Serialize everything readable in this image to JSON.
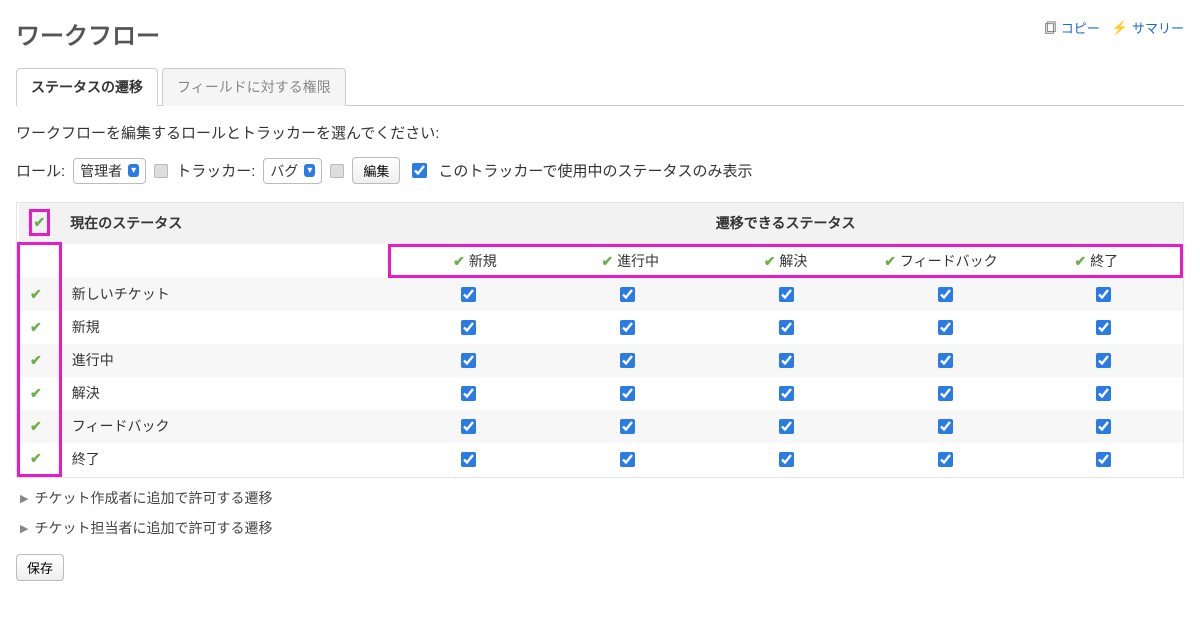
{
  "header": {
    "title": "ワークフロー",
    "links": {
      "copy": "コピー",
      "summary": "サマリー"
    }
  },
  "tabs": {
    "status_transition": "ステータスの遷移",
    "field_permission": "フィールドに対する権限"
  },
  "instruction": "ワークフローを編集するロールとトラッカーを選んでください:",
  "filters": {
    "role_label": "ロール:",
    "role_value": "管理者",
    "tracker_label": "トラッカー:",
    "tracker_value": "バグ",
    "edit_button": "編集",
    "used_only_label": "このトラッカーで使用中のステータスのみ表示"
  },
  "matrix": {
    "current_status_header": "現在のステータス",
    "allowed_header": "遷移できるステータス",
    "columns": [
      "新規",
      "進行中",
      "解決",
      "フィードバック",
      "終了"
    ],
    "rows": [
      "新しいチケット",
      "新規",
      "進行中",
      "解決",
      "フィードバック",
      "終了"
    ]
  },
  "expanders": {
    "author": "チケット作成者に追加で許可する遷移",
    "assignee": "チケット担当者に追加で許可する遷移"
  },
  "save_button": "保存"
}
